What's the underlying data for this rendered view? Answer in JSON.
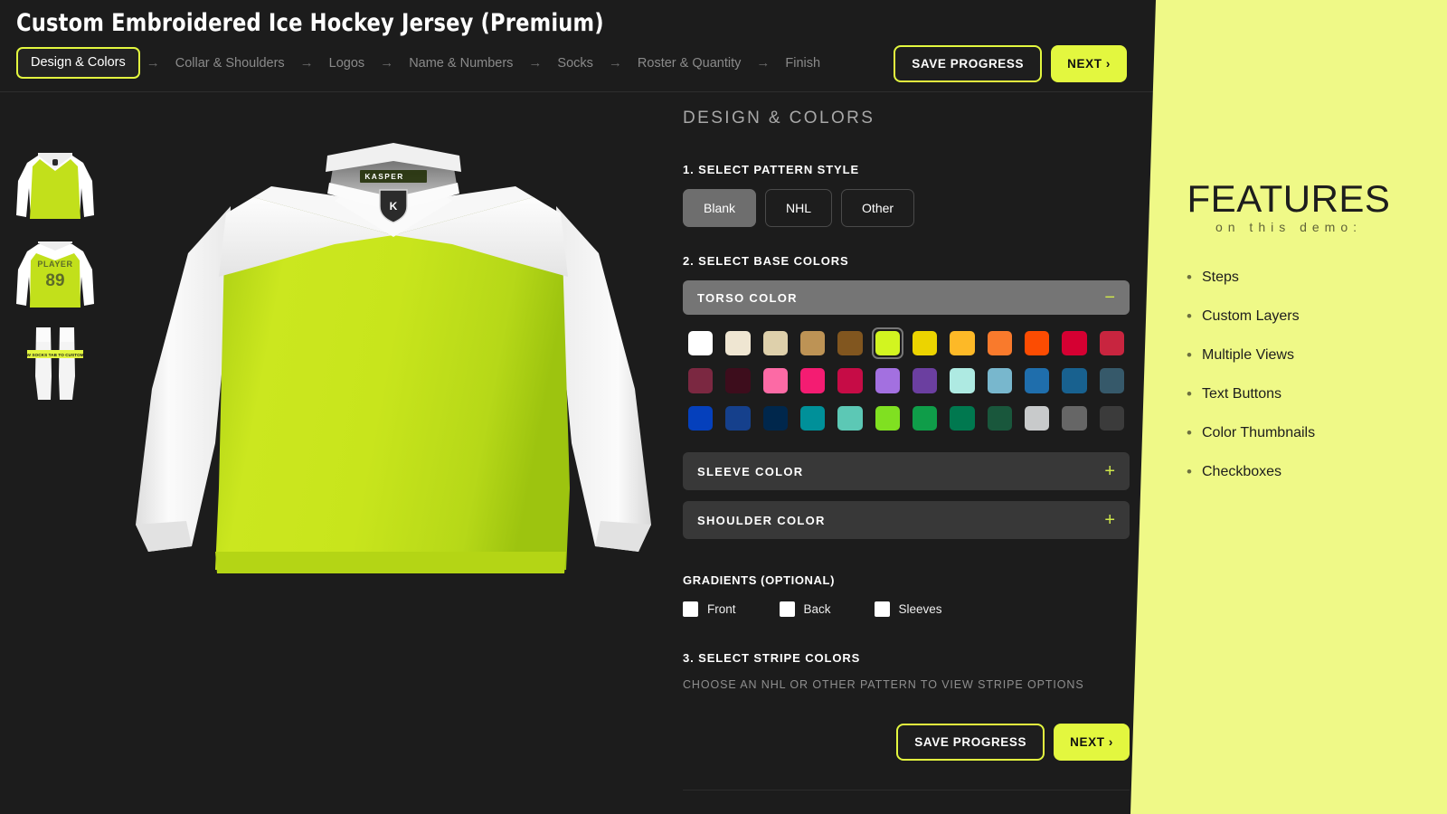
{
  "header": {
    "title": "Custom Embroidered Ice Hockey Jersey (Premium)",
    "steps": [
      {
        "label": "Design & Colors",
        "active": true
      },
      {
        "label": "Collar & Shoulders",
        "active": false
      },
      {
        "label": "Logos",
        "active": false
      },
      {
        "label": "Name & Numbers",
        "active": false
      },
      {
        "label": "Socks",
        "active": false
      },
      {
        "label": "Roster & Quantity",
        "active": false
      },
      {
        "label": "Finish",
        "active": false
      }
    ],
    "step_arrow": "→",
    "save_label": "SAVE PROGRESS",
    "next_label": "NEXT ›"
  },
  "thumbnails": [
    {
      "name": "front-view",
      "body_color": "#c2e01b",
      "sleeve_color": "#ffffff"
    },
    {
      "name": "back-view",
      "body_color": "#c2e01b",
      "sleeve_color": "#ffffff",
      "player_text": "PLAYER",
      "number_text": "89"
    },
    {
      "name": "socks-view",
      "sock_color": "#f2f2f2",
      "badge_text": "VIEW SOCKS TAB TO CUSTOMIZE"
    }
  ],
  "preview": {
    "body_color": "#c2e01b",
    "sleeve_color": "#ffffff",
    "shoulder_color": "#ffffff",
    "brand_tag": "KASPER",
    "crest_letter": "K"
  },
  "panel": {
    "title": "DESIGN & COLORS",
    "pattern_section": {
      "label": "1. SELECT PATTERN STYLE",
      "options": [
        {
          "label": "Blank",
          "selected": true
        },
        {
          "label": "NHL",
          "selected": false
        },
        {
          "label": "Other",
          "selected": false
        }
      ]
    },
    "base_colors_label": "2. SELECT BASE COLORS",
    "accordions": [
      {
        "title": "TORSO COLOR",
        "open": true,
        "sign": "−"
      },
      {
        "title": "SLEEVE COLOR",
        "open": false,
        "sign": "+"
      },
      {
        "title": "SHOULDER COLOR",
        "open": false,
        "sign": "+"
      }
    ],
    "torso_swatches": [
      {
        "hex": "#ffffff",
        "selected": false
      },
      {
        "hex": "#efe6d2",
        "selected": false
      },
      {
        "hex": "#ded0ab",
        "selected": false
      },
      {
        "hex": "#bd9355",
        "selected": false
      },
      {
        "hex": "#81561f",
        "selected": false
      },
      {
        "hex": "#d2f520",
        "selected": true
      },
      {
        "hex": "#ecd400",
        "selected": false
      },
      {
        "hex": "#fdb927",
        "selected": false
      },
      {
        "hex": "#f97a2c",
        "selected": false
      },
      {
        "hex": "#fc4c02",
        "selected": false
      },
      {
        "hex": "#d50032",
        "selected": false
      },
      {
        "hex": "#c8253f",
        "selected": false
      },
      {
        "hex": "#7b2841",
        "selected": false
      },
      {
        "hex": "#3d0d1c",
        "selected": false
      },
      {
        "hex": "#fc6aa5",
        "selected": false
      },
      {
        "hex": "#f41c72",
        "selected": false
      },
      {
        "hex": "#c60c46",
        "selected": false
      },
      {
        "hex": "#a370e0",
        "selected": false
      },
      {
        "hex": "#6b3fa0",
        "selected": false
      },
      {
        "hex": "#aeeae2",
        "selected": false
      },
      {
        "hex": "#78b7cd",
        "selected": false
      },
      {
        "hex": "#1f6eac",
        "selected": false
      },
      {
        "hex": "#18618f",
        "selected": false
      },
      {
        "hex": "#36596a",
        "selected": false
      },
      {
        "hex": "#0540bc",
        "selected": false
      },
      {
        "hex": "#15408c",
        "selected": false
      },
      {
        "hex": "#00274c",
        "selected": false
      },
      {
        "hex": "#009099",
        "selected": false
      },
      {
        "hex": "#5cc8b5",
        "selected": false
      },
      {
        "hex": "#80e021",
        "selected": false
      },
      {
        "hex": "#0f9d49",
        "selected": false
      },
      {
        "hex": "#00784f",
        "selected": false
      },
      {
        "hex": "#19573c",
        "selected": false
      },
      {
        "hex": "#c8cacb",
        "selected": false
      },
      {
        "hex": "#666666",
        "selected": false
      },
      {
        "hex": "#3b3b3b",
        "selected": false
      }
    ],
    "gradients": {
      "label": "GRADIENTS (OPTIONAL)",
      "options": [
        {
          "label": "Front",
          "checked": false
        },
        {
          "label": "Back",
          "checked": false
        },
        {
          "label": "Sleeves",
          "checked": false
        }
      ]
    },
    "stripe_section": {
      "label": "3. SELECT STRIPE COLORS",
      "note": "CHOOSE AN NHL OR OTHER PATTERN TO VIEW STRIPE OPTIONS"
    },
    "save_label": "SAVE PROGRESS",
    "next_label": "NEXT ›"
  },
  "features": {
    "title": "FEATURES",
    "subtitle": "on this demo:",
    "items": [
      "Steps",
      "Custom Layers",
      "Multiple Views",
      "Text Buttons",
      "Color Thumbnails",
      "Checkboxes"
    ]
  },
  "theme": {
    "accent": "#e3f73f",
    "features_bg": "#eff987",
    "page_bg": "#1c1c1c"
  }
}
